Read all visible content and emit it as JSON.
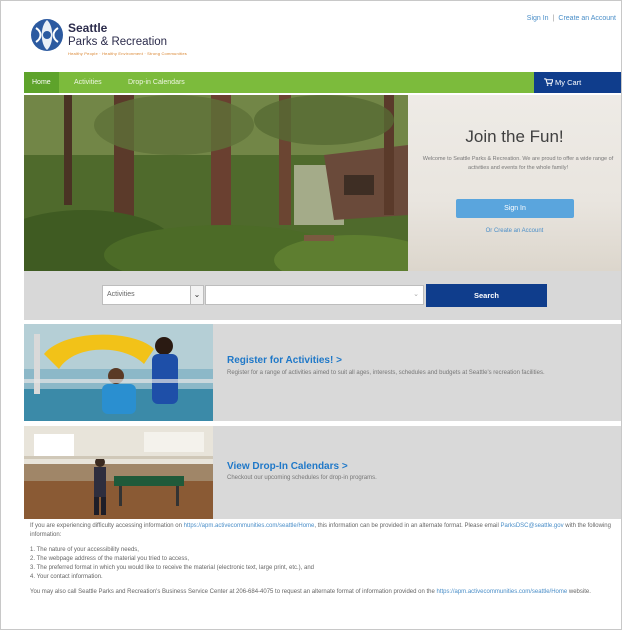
{
  "header": {
    "logo_title": "Seattle",
    "logo_subtitle": "Parks & Recreation",
    "logo_tagline": "Healthy People · Healthy Environment · Strong Communities",
    "sign_in": "Sign In",
    "separator": "|",
    "create_account": "Create an Account"
  },
  "nav": {
    "items": [
      "Home",
      "Activities",
      "Drop-in Calendars"
    ],
    "cart": "My Cart"
  },
  "hero": {
    "title": "Join the Fun!",
    "text": "Welcome to Seattle Parks & Recreation. We are proud to offer a wide range of activities and events for the whole family!",
    "sign_in_button": "Sign In",
    "create_link": "Or Create an Account"
  },
  "search": {
    "category": "Activities",
    "input_value": "",
    "button": "Search"
  },
  "panels": [
    {
      "title": "Register for Activities! >",
      "description": "Register for a range of activities aimed to suit all ages, interests, schedules and budgets at Seattle's recreation facilities."
    },
    {
      "title": "View Drop-In Calendars >",
      "description": "Checkout our upcoming schedules for drop-in programs."
    }
  ],
  "footer": {
    "intro_1": "If you are experiencing difficulty accessing information on",
    "link_1": "https://apm.activecommunities.com/seattle/Home",
    "intro_2": ", this information can be provided in an alternate format. Please email",
    "email": "ParksDSC@seattle.gov",
    "intro_3": "with the following information:",
    "list": [
      "1. The nature of your accessibility needs,",
      "2. The webpage address of the material you tried to access,",
      "3. The preferred format in which you would like to receive the material (electronic text, large print, etc.), and",
      "4. Your contact information."
    ],
    "outro_1": "You may also call Seattle Parks and Recreation's Business Service Center at 206-684-4075 to request an alternate format of information provided on the",
    "link_2": "https://apm.activecommunities.com/seattle/Home",
    "outro_2": "website."
  },
  "colors": {
    "nav_green": "#7cbb3c",
    "nav_active": "#5ea32b",
    "navy": "#0f3d8c",
    "link_blue": "#1f78c8",
    "button_blue": "#5aa5dd",
    "panel_gray": "#d9d9d9"
  }
}
